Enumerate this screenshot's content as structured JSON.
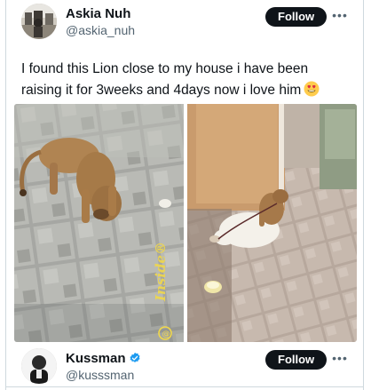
{
  "post": {
    "author": {
      "display_name": "Askia Nuh",
      "handle": "@askia_nuh",
      "avatar": "avatar-photo"
    },
    "follow_label": "Follow",
    "more_icon": "more-horizontal-icon",
    "text": "I found this Lion close to my house i have been raising it for 3weeks and 4days now i love him",
    "emoji": "heart-eyes-emoji",
    "media": {
      "left_photo": "lion-cub-on-tiles",
      "right_photo": "lion-cub-playing-with-goat",
      "watermark": "Inside®"
    }
  },
  "next_post": {
    "author": {
      "display_name": "Kussman",
      "handle": "@kusssman",
      "verified_icon": "verified-badge-icon"
    },
    "follow_label": "Follow",
    "more_icon": "more-horizontal-icon"
  },
  "colors": {
    "follow_bg": "#0f1419",
    "handle": "#536471",
    "verified": "#1d9bf0",
    "border": "#cfd9de"
  }
}
